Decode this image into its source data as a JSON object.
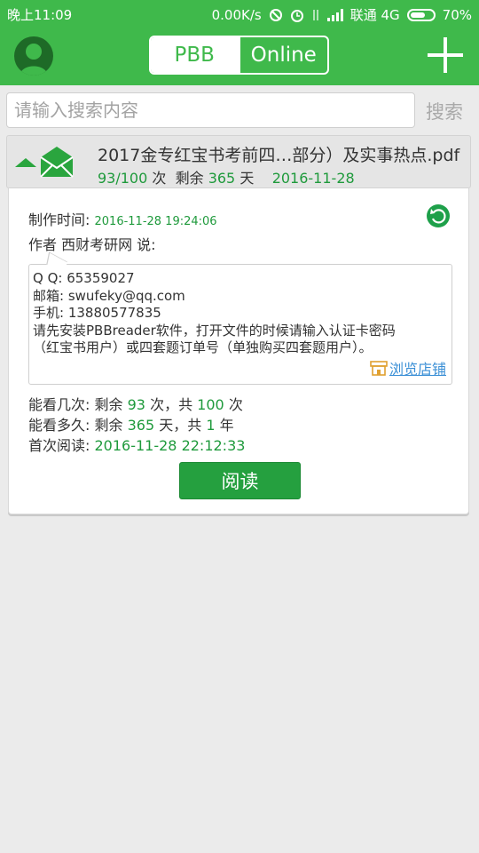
{
  "status": {
    "time": "晚上11:09",
    "speed": "0.00K/s",
    "carrier": "联通 4G",
    "battery": "70%",
    "battery_level": 0.7
  },
  "header": {
    "tab_pbb": "PBB",
    "tab_online": "Online",
    "avatar_icon": "user-avatar-icon",
    "add_icon": "plus-icon"
  },
  "search": {
    "placeholder": "请输入搜索内容",
    "button": "搜索"
  },
  "file": {
    "name": "2017金专红宝书考前四…部分）及实事热点.pdf",
    "views_used": "93",
    "views_total": "100",
    "views_unit": "次",
    "remaining_label": "剩余",
    "remaining_days": "365",
    "days_unit": "天",
    "date": "2016-11-28"
  },
  "detail": {
    "created_label": "制作时间:",
    "created_value": "2016-11-28 19:24:06",
    "author_line": "作者 西财考研网 说:",
    "intro_lines": [
      "Q  Q: 65359027",
      "邮箱: swufeky@qq.com",
      "手机: 13880577835",
      "请先安装PBBreader软件，打开文件的时候请输入认证卡密码",
      "（红宝书用户）或四套题订单号（单独购买四套题用户）。"
    ],
    "shop_link": "浏览店铺",
    "times_label": "能看几次:",
    "times_remaining_pre": "剩余",
    "times_remaining": "93",
    "times_mid": "次，共",
    "times_total": "100",
    "times_unit": "次",
    "duration_label": "能看多久:",
    "duration_pre": "剩余",
    "duration_days": "365",
    "duration_mid": "天，共",
    "duration_years": "1",
    "duration_unit": "年",
    "first_read_label": "首次阅读:",
    "first_read_value": "2016-11-28 22:12:33",
    "read_button": "阅读"
  }
}
